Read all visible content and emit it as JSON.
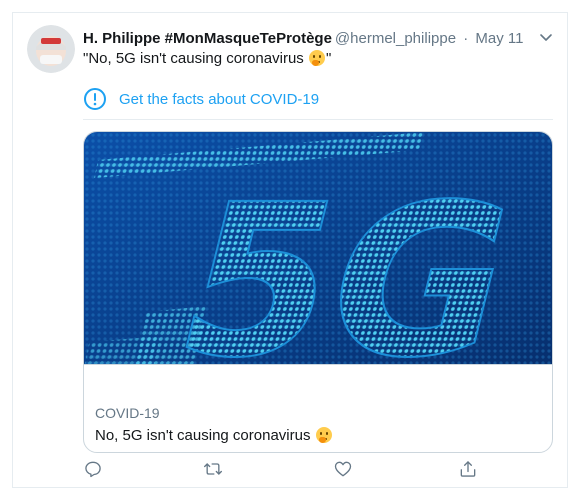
{
  "tweet": {
    "author_name": "H. Philippe #MonMasqueTeProtège",
    "handle": "@hermel_philippe",
    "separator": "·",
    "date": "May 11",
    "text_before": "\"No, 5G isn't causing coronavirus",
    "text_after": "\"",
    "emoji": "thinking-face"
  },
  "facts_link": {
    "label": "Get the facts about COVID-19",
    "icon": "exclamation-circle-icon"
  },
  "card": {
    "image_text": "5G",
    "domain": "COVID-19",
    "title": "No, 5G isn't causing coronavirus",
    "emoji": "thinking-face"
  },
  "actions": [
    "reply-icon",
    "retweet-icon",
    "like-icon",
    "share-icon"
  ],
  "colors": {
    "accent": "#1da1f2",
    "text": "#14171a",
    "secondary": "#657786",
    "border": "#e6ecf0",
    "image_bg": "#0a3d86",
    "image_glyph": "#3dbde6"
  }
}
